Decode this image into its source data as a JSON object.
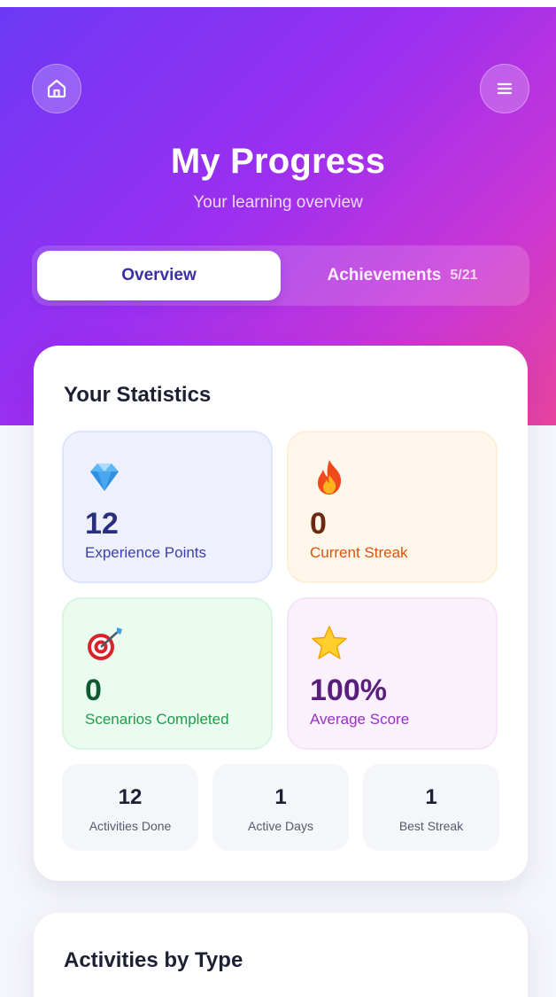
{
  "header": {
    "title": "My Progress",
    "subtitle": "Your learning overview",
    "home_icon": "home-icon",
    "menu_icon": "hamburger-menu-icon"
  },
  "tabs": [
    {
      "label": "Overview",
      "active": true
    },
    {
      "label": "Achievements",
      "count": "5/21",
      "active": false
    }
  ],
  "statistics": {
    "title": "Your Statistics",
    "tiles": [
      {
        "icon": "diamond-icon",
        "value": "12",
        "label": "Experience Points",
        "color": "#3b3fae"
      },
      {
        "icon": "fire-icon",
        "value": "0",
        "label": "Current Streak",
        "color": "#d9550e"
      },
      {
        "icon": "target-icon",
        "value": "0",
        "label": "Scenarios Completed",
        "color": "#1e9d4a"
      },
      {
        "icon": "star-icon",
        "value": "100%",
        "label": "Average Score",
        "color": "#9a2fc7"
      }
    ],
    "mini": [
      {
        "value": "12",
        "label": "Activities Done"
      },
      {
        "value": "1",
        "label": "Active Days"
      },
      {
        "value": "1",
        "label": "Best Streak"
      }
    ]
  },
  "activities": {
    "title": "Activities by Type"
  },
  "colors": {
    "gradient_start": "#6b39f5",
    "gradient_end": "#e8439e",
    "active_tab_text": "#3b2fa8"
  }
}
